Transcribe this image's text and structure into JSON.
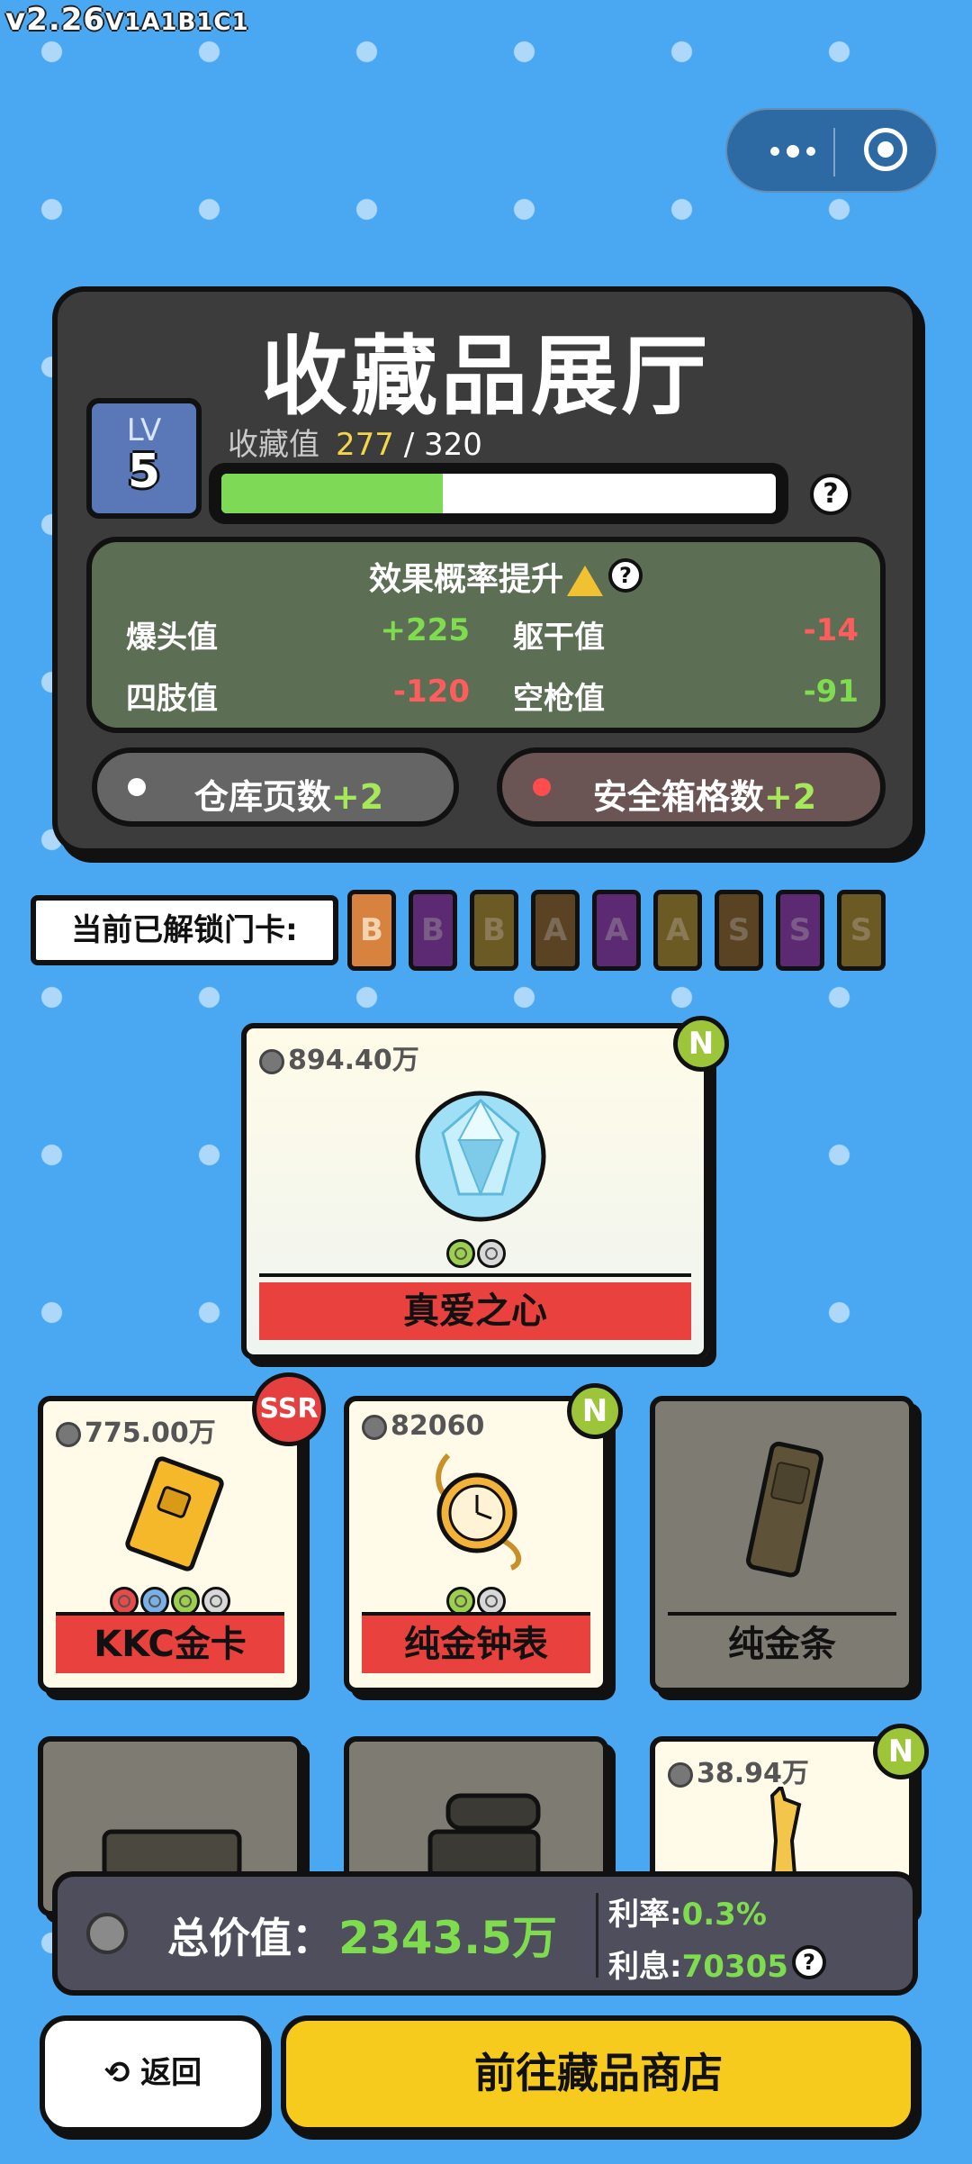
{
  "version": {
    "main": "v2.26",
    "suffix": "V1A1B1C1"
  },
  "title": "收藏品展厅",
  "level": {
    "label": "LV",
    "value": "5"
  },
  "collection": {
    "label": "收藏值",
    "current": "277",
    "sep": "/",
    "total": "320",
    "progress": 0.4
  },
  "effect": {
    "title": "效果概率提升",
    "stats": [
      {
        "label": "爆头值",
        "value": "+225",
        "tone": "pos"
      },
      {
        "label": "躯干值",
        "value": "-14",
        "tone": "neg"
      },
      {
        "label": "四肢值",
        "value": "-120",
        "tone": "neg"
      },
      {
        "label": "空枪值",
        "value": "-91",
        "tone": "pos"
      }
    ]
  },
  "buttons": {
    "warehouse": {
      "label": "仓库页数",
      "plus": "+2"
    },
    "safebox": {
      "label": "安全箱格数",
      "plus": "+2"
    }
  },
  "unlock": {
    "label": "当前已解锁门卡:",
    "cards": [
      "B",
      "B",
      "B",
      "A",
      "A",
      "A",
      "S",
      "S",
      "S"
    ]
  },
  "featured": {
    "price": "894.40万",
    "name": "真爱之心",
    "rarity": "N"
  },
  "items": [
    {
      "price": "775.00万",
      "name": "KKC金卡",
      "rarity": "SSR"
    },
    {
      "price": "82060",
      "name": "纯金钟表",
      "rarity": "N"
    },
    {
      "name": "纯金条"
    },
    {
      "price": "38.94万",
      "rarity": "N"
    }
  ],
  "summary": {
    "total_label": "总价值：",
    "total_value": "2343.5万",
    "rate_label": "利率:",
    "rate_value": "0.3%",
    "interest_label": "利息:",
    "interest_value": "70305"
  },
  "footer": {
    "back": "返回",
    "shop": "前往藏品商店"
  },
  "colors": {
    "background": "#4aa8f2",
    "accent": "#f7cb1d",
    "positive": "#7fdc4e",
    "negative": "#ff5d5d"
  }
}
